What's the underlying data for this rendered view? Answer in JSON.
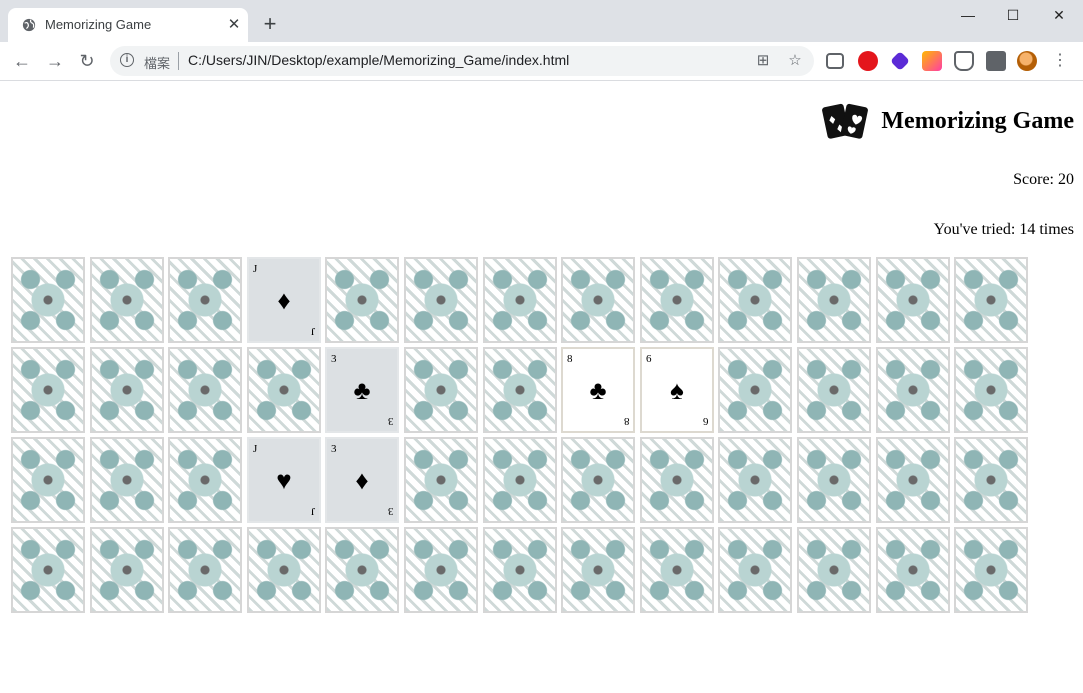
{
  "browser": {
    "tab_title": "Memorizing Game",
    "scheme_label": "檔案",
    "url": "C:/Users/JIN/Desktop/example/Memorizing_Game/index.html",
    "new_tab_label": "+"
  },
  "page": {
    "title": "Memorizing Game",
    "score_text": "Score: 20",
    "tries_text": "You've tried: 14 times"
  },
  "board": {
    "columns": 13,
    "rows": 4,
    "cards": [
      {
        "state": "back"
      },
      {
        "state": "back"
      },
      {
        "state": "back"
      },
      {
        "state": "face",
        "rank": "J",
        "suit": "♦",
        "suit_name": "diamonds"
      },
      {
        "state": "back"
      },
      {
        "state": "back"
      },
      {
        "state": "back"
      },
      {
        "state": "back"
      },
      {
        "state": "back"
      },
      {
        "state": "back"
      },
      {
        "state": "back"
      },
      {
        "state": "back"
      },
      {
        "state": "back"
      },
      {
        "state": "back"
      },
      {
        "state": "back"
      },
      {
        "state": "back"
      },
      {
        "state": "back"
      },
      {
        "state": "face",
        "rank": "3",
        "suit": "♣",
        "suit_name": "clubs"
      },
      {
        "state": "back"
      },
      {
        "state": "back"
      },
      {
        "state": "face",
        "rank": "8",
        "suit": "♣",
        "suit_name": "clubs",
        "style": "white"
      },
      {
        "state": "face",
        "rank": "6",
        "suit": "♠",
        "suit_name": "spades",
        "style": "white"
      },
      {
        "state": "back"
      },
      {
        "state": "back"
      },
      {
        "state": "back"
      },
      {
        "state": "back"
      },
      {
        "state": "back"
      },
      {
        "state": "back"
      },
      {
        "state": "back"
      },
      {
        "state": "face",
        "rank": "J",
        "suit": "♥",
        "suit_name": "hearts"
      },
      {
        "state": "face",
        "rank": "3",
        "suit": "♦",
        "suit_name": "diamonds"
      },
      {
        "state": "back"
      },
      {
        "state": "back"
      },
      {
        "state": "back"
      },
      {
        "state": "back"
      },
      {
        "state": "back"
      },
      {
        "state": "back"
      },
      {
        "state": "back"
      },
      {
        "state": "back"
      },
      {
        "state": "back"
      },
      {
        "state": "back"
      },
      {
        "state": "back"
      },
      {
        "state": "back"
      },
      {
        "state": "back"
      },
      {
        "state": "back"
      },
      {
        "state": "back"
      },
      {
        "state": "back"
      },
      {
        "state": "back"
      },
      {
        "state": "back"
      },
      {
        "state": "back"
      },
      {
        "state": "back"
      },
      {
        "state": "back"
      }
    ]
  },
  "colors": {
    "chrome_bg": "#dee1e6",
    "omnibox_bg": "#f1f3f4",
    "face_card_bg": "#dce0e3",
    "white_card_bg": "#ffffff"
  }
}
